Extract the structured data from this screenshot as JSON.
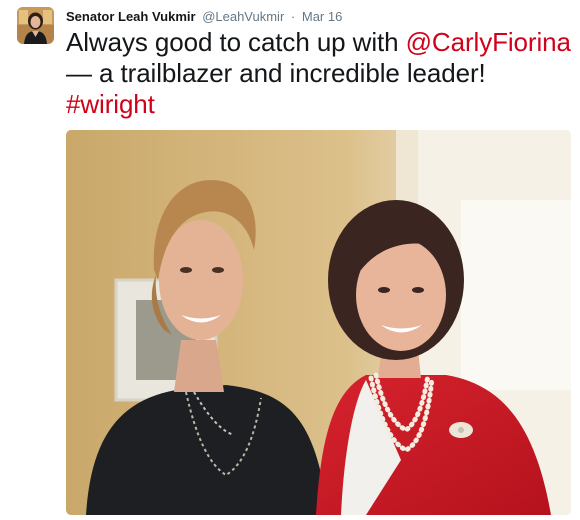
{
  "tweet": {
    "display_name": "Senator Leah Vukmir",
    "handle": "@LeahVukmir",
    "separator": "·",
    "timestamp": "Mar 16",
    "text_line1": "Always good to catch up with ",
    "mention": "@CarlyFiorina",
    "text_line2": "— a trailblazer and incredible leader!",
    "hashtag": "#wiright"
  },
  "colors": {
    "link": "#d0021b",
    "text": "#14171a",
    "secondary": "#657786"
  },
  "photo": {
    "subject": "photo of two women smiling, one in black top with long necklace, one in red jacket with pearl necklace and brooch"
  }
}
